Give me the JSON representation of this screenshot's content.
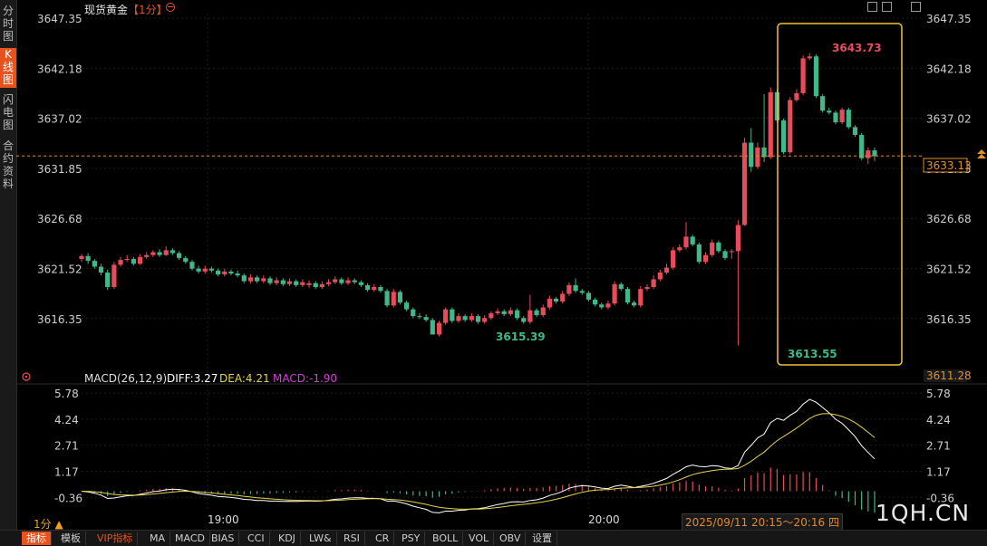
{
  "sidebar": {
    "tabs": [
      {
        "label": "分时图",
        "active": false
      },
      {
        "label": "K线图",
        "active": true
      },
      {
        "label": "闪电图",
        "active": false
      },
      {
        "label": "合约资料",
        "active": false
      }
    ]
  },
  "header": {
    "title": "现货黄金",
    "period": "【1分】",
    "period_icon": "circle-minus-icon"
  },
  "toolbar_icons": [
    "crosshair-icon",
    "zoom-icon",
    "restore-icon"
  ],
  "price_chart": {
    "y_ticks": [
      "3647.35",
      "3642.18",
      "3637.02",
      "3631.85",
      "3626.68",
      "3621.52",
      "3616.35"
    ],
    "current_price": "3633.13",
    "lower_price": "3611.28",
    "annotations": {
      "high": "3643.73",
      "low_left": "3615.39",
      "low_right": "3613.55"
    },
    "colors": {
      "up": "#e84b5a",
      "down": "#3fb88a",
      "price_line": "#e0902a",
      "highlight_box": "#f2c230"
    }
  },
  "macd_panel": {
    "title": "MACD(26,12,9)",
    "diff_label": "DIFF:3.27",
    "dea_label": "DEA:4.21",
    "macd_label": "MACD:-1.90",
    "y_ticks": [
      "5.78",
      "4.24",
      "2.71",
      "1.17",
      "-0.36"
    ],
    "colors": {
      "diff": "#ffffff",
      "dea": "#e6d24a",
      "macd": "#d63fd6"
    }
  },
  "x_axis": {
    "labels": [
      "19:00",
      "20:00"
    ],
    "period_label": "1分 ▲",
    "range_label": "2025/09/11 20:15～20:16 四"
  },
  "bottom_tabs": [
    {
      "label": "指标",
      "active": true
    },
    {
      "label": "模板",
      "active": false
    },
    {
      "label": "VIP指标",
      "active": false,
      "vip": true
    },
    {
      "label": "MA",
      "active": false
    },
    {
      "label": "MACD",
      "active": false
    },
    {
      "label": "BIAS",
      "active": false
    },
    {
      "label": "CCI",
      "active": false
    },
    {
      "label": "KDJ",
      "active": false
    },
    {
      "label": "LW&",
      "active": false
    },
    {
      "label": "RSI",
      "active": false
    },
    {
      "label": "CR",
      "active": false
    },
    {
      "label": "PSY",
      "active": false
    },
    {
      "label": "BOLL",
      "active": false
    },
    {
      "label": "VOL",
      "active": false
    },
    {
      "label": "OBV",
      "active": false
    },
    {
      "label": "设置",
      "active": false
    }
  ],
  "watermark": "1QH.CN",
  "chart_data": {
    "type": "candlestick",
    "ylim": [
      3612.5,
      3647.35
    ],
    "y_ticks": [
      3647.35,
      3642.18,
      3637.02,
      3631.85,
      3626.68,
      3621.52,
      3616.35
    ],
    "x_labels": [
      "19:00",
      "20:00"
    ],
    "current_price": 3633.13,
    "candles": [
      [
        3622.5,
        3622.8,
        3623.0,
        3622.2
      ],
      [
        3622.8,
        3622.3,
        3623.1,
        3622.0
      ],
      [
        3622.3,
        3621.7,
        3622.5,
        3621.5
      ],
      [
        3621.7,
        3621.1,
        3622.0,
        3620.8
      ],
      [
        3621.1,
        3619.6,
        3621.4,
        3619.3
      ],
      [
        3619.6,
        3621.9,
        3622.2,
        3619.4
      ],
      [
        3621.9,
        3622.4,
        3622.7,
        3621.7
      ],
      [
        3622.4,
        3622.5,
        3622.9,
        3622.2
      ],
      [
        3622.5,
        3622.0,
        3622.7,
        3621.8
      ],
      [
        3622.0,
        3622.7,
        3623.0,
        3621.9
      ],
      [
        3622.7,
        3622.9,
        3623.2,
        3622.5
      ],
      [
        3622.9,
        3623.2,
        3623.4,
        3622.7
      ],
      [
        3623.2,
        3622.9,
        3623.5,
        3622.7
      ],
      [
        3622.9,
        3623.4,
        3623.8,
        3622.8
      ],
      [
        3623.4,
        3623.1,
        3623.6,
        3622.9
      ],
      [
        3623.1,
        3622.6,
        3623.3,
        3622.4
      ],
      [
        3622.6,
        3622.2,
        3622.8,
        3622.0
      ],
      [
        3622.2,
        3621.5,
        3622.4,
        3621.3
      ],
      [
        3621.5,
        3621.2,
        3621.8,
        3621.0
      ],
      [
        3621.2,
        3621.5,
        3621.8,
        3621.0
      ],
      [
        3621.5,
        3621.3,
        3621.7,
        3621.1
      ],
      [
        3621.3,
        3620.9,
        3621.5,
        3620.7
      ],
      [
        3620.9,
        3621.2,
        3621.5,
        3620.7
      ],
      [
        3621.2,
        3621.0,
        3621.4,
        3620.8
      ],
      [
        3621.0,
        3620.8,
        3621.3,
        3620.6
      ],
      [
        3620.8,
        3620.2,
        3621.0,
        3620.0
      ],
      [
        3620.2,
        3620.6,
        3620.9,
        3620.0
      ],
      [
        3620.6,
        3620.2,
        3620.8,
        3620.0
      ],
      [
        3620.2,
        3620.5,
        3620.8,
        3620.0
      ],
      [
        3620.5,
        3620.0,
        3620.7,
        3619.8
      ],
      [
        3620.0,
        3620.3,
        3620.6,
        3619.8
      ],
      [
        3620.3,
        3619.9,
        3620.5,
        3619.7
      ],
      [
        3619.9,
        3620.2,
        3620.5,
        3619.7
      ],
      [
        3620.2,
        3619.8,
        3620.4,
        3619.6
      ],
      [
        3619.8,
        3620.1,
        3620.4,
        3619.6
      ],
      [
        3619.8,
        3620.0,
        3620.3,
        3619.5
      ],
      [
        3620.0,
        3619.6,
        3620.2,
        3619.4
      ],
      [
        3619.6,
        3619.9,
        3620.2,
        3619.4
      ],
      [
        3619.9,
        3620.1,
        3620.4,
        3619.7
      ],
      [
        3620.1,
        3620.4,
        3620.7,
        3619.9
      ],
      [
        3620.4,
        3620.0,
        3620.6,
        3619.8
      ],
      [
        3620.0,
        3620.3,
        3620.6,
        3619.8
      ],
      [
        3620.3,
        3620.1,
        3620.5,
        3619.9
      ],
      [
        3620.1,
        3619.8,
        3620.3,
        3619.6
      ],
      [
        3619.8,
        3619.3,
        3620.0,
        3619.1
      ],
      [
        3619.3,
        3619.6,
        3619.9,
        3619.1
      ],
      [
        3619.6,
        3619.2,
        3619.8,
        3619.0
      ],
      [
        3619.2,
        3617.7,
        3619.4,
        3617.5
      ],
      [
        3617.7,
        3619.1,
        3619.4,
        3617.5
      ],
      [
        3619.1,
        3618.0,
        3619.3,
        3617.8
      ],
      [
        3618.0,
        3617.3,
        3618.2,
        3617.1
      ],
      [
        3617.3,
        3616.6,
        3617.5,
        3616.4
      ],
      [
        3616.6,
        3616.5,
        3616.9,
        3616.3
      ],
      [
        3616.5,
        3616.2,
        3616.8,
        3616.0
      ],
      [
        3616.2,
        3614.7,
        3616.4,
        3615.4
      ],
      [
        3614.7,
        3615.9,
        3616.1,
        3614.5
      ],
      [
        3615.9,
        3617.3,
        3617.5,
        3615.7
      ],
      [
        3617.3,
        3616.1,
        3617.5,
        3615.9
      ],
      [
        3616.1,
        3616.6,
        3616.9,
        3615.9
      ],
      [
        3616.6,
        3616.2,
        3616.8,
        3616.0
      ],
      [
        3616.2,
        3616.6,
        3616.9,
        3616.0
      ],
      [
        3616.6,
        3616.0,
        3616.8,
        3615.8
      ],
      [
        3616.0,
        3616.4,
        3616.7,
        3615.8
      ],
      [
        3616.4,
        3616.9,
        3617.1,
        3616.2
      ],
      [
        3616.9,
        3617.1,
        3617.4,
        3616.7
      ],
      [
        3617.1,
        3616.8,
        3617.3,
        3616.6
      ],
      [
        3616.8,
        3617.2,
        3617.5,
        3616.6
      ],
      [
        3617.2,
        3616.4,
        3617.4,
        3616.2
      ],
      [
        3616.4,
        3616.0,
        3616.6,
        3615.8
      ],
      [
        3616.0,
        3617.2,
        3618.8,
        3615.8
      ],
      [
        3617.2,
        3616.7,
        3617.4,
        3616.5
      ],
      [
        3616.7,
        3617.5,
        3617.8,
        3616.5
      ],
      [
        3617.5,
        3618.4,
        3618.7,
        3617.3
      ],
      [
        3618.4,
        3618.1,
        3618.6,
        3617.9
      ],
      [
        3618.1,
        3618.9,
        3619.2,
        3617.9
      ],
      [
        3618.9,
        3619.8,
        3620.1,
        3618.7
      ],
      [
        3619.8,
        3619.2,
        3620.5,
        3619.0
      ],
      [
        3619.2,
        3619.0,
        3619.4,
        3618.8
      ],
      [
        3619.0,
        3618.3,
        3619.2,
        3618.1
      ],
      [
        3618.3,
        3617.8,
        3618.5,
        3617.6
      ],
      [
        3617.8,
        3617.5,
        3618.0,
        3617.3
      ],
      [
        3617.5,
        3617.9,
        3618.2,
        3617.3
      ],
      [
        3617.9,
        3619.9,
        3620.2,
        3617.7
      ],
      [
        3619.9,
        3619.4,
        3620.1,
        3619.2
      ],
      [
        3619.4,
        3618.0,
        3619.6,
        3617.8
      ],
      [
        3618.0,
        3617.7,
        3618.2,
        3617.5
      ],
      [
        3617.7,
        3619.4,
        3619.7,
        3617.5
      ],
      [
        3619.4,
        3619.6,
        3619.9,
        3619.2
      ],
      [
        3619.6,
        3620.4,
        3620.8,
        3619.4
      ],
      [
        3620.4,
        3621.1,
        3621.4,
        3620.2
      ],
      [
        3621.1,
        3621.6,
        3622.0,
        3620.9
      ],
      [
        3621.6,
        3623.4,
        3623.7,
        3621.4
      ],
      [
        3623.4,
        3623.7,
        3624.0,
        3623.2
      ],
      [
        3623.7,
        3624.8,
        3626.3,
        3623.5
      ],
      [
        3624.8,
        3624.0,
        3625.0,
        3623.8
      ],
      [
        3624.0,
        3622.2,
        3624.2,
        3622.0
      ],
      [
        3622.2,
        3622.9,
        3623.2,
        3622.0
      ],
      [
        3622.9,
        3624.2,
        3624.5,
        3622.7
      ],
      [
        3624.2,
        3623.3,
        3624.4,
        3623.1
      ],
      [
        3623.3,
        3622.6,
        3623.5,
        3622.4
      ],
      [
        3623.3,
        3623.3,
        3623.5,
        3622.5
      ],
      [
        3623.3,
        3626.0,
        3626.5,
        3613.55
      ],
      [
        3626.0,
        3634.5,
        3635.0,
        3625.9
      ],
      [
        3634.5,
        3632.0,
        3636.0,
        3631.5
      ],
      [
        3632.0,
        3634.0,
        3634.5,
        3631.8
      ],
      [
        3634.0,
        3633.0,
        3639.5,
        3632.5
      ],
      [
        3633.0,
        3639.7,
        3640.2,
        3632.8
      ],
      [
        3639.7,
        3636.8,
        3640.0,
        3636.6
      ],
      [
        3636.8,
        3633.5,
        3637.0,
        3633.3
      ],
      [
        3633.5,
        3638.9,
        3639.2,
        3633.3
      ],
      [
        3638.9,
        3639.6,
        3640.0,
        3638.7
      ],
      [
        3639.6,
        3643.2,
        3643.5,
        3639.4
      ],
      [
        3643.2,
        3643.4,
        3643.73,
        3643.0
      ],
      [
        3643.4,
        3639.3,
        3643.6,
        3639.1
      ],
      [
        3639.3,
        3637.8,
        3639.5,
        3637.6
      ],
      [
        3637.8,
        3637.6,
        3638.1,
        3637.4
      ],
      [
        3637.6,
        3636.6,
        3637.8,
        3636.4
      ],
      [
        3636.6,
        3637.9,
        3638.1,
        3636.4
      ],
      [
        3637.9,
        3636.1,
        3638.1,
        3635.9
      ],
      [
        3636.1,
        3635.3,
        3636.3,
        3635.1
      ],
      [
        3635.3,
        3632.9,
        3635.5,
        3632.7
      ],
      [
        3632.9,
        3633.7,
        3634.0,
        3632.3
      ],
      [
        3633.7,
        3633.1,
        3634.0,
        3632.6
      ]
    ],
    "macd": {
      "diff_latest": 3.27,
      "dea_latest": 4.21,
      "macd_latest": -1.9,
      "ylim": [
        -1.2,
        6.0
      ],
      "y_ticks": [
        5.78,
        4.24,
        2.71,
        1.17,
        -0.36
      ]
    }
  }
}
